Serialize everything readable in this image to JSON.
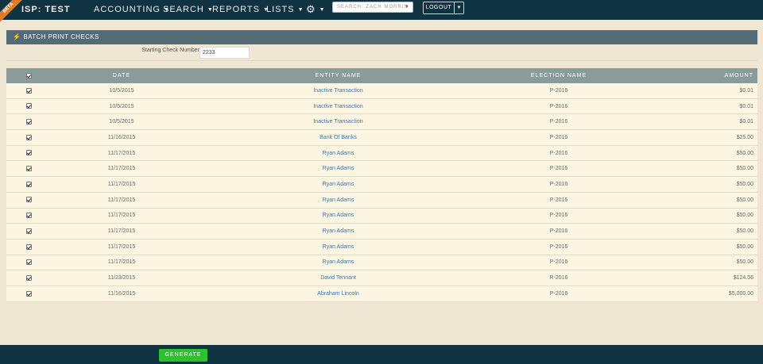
{
  "nav": {
    "beta": "BETA",
    "brand": "ISP: TEST",
    "accounting": "ACCOUNTING",
    "search": "SEARCH",
    "reports": "REPORTS",
    "lists": "LISTS",
    "gear": "⚙",
    "user_search_value": "SEARCH: ZACH MORRIS",
    "logout": "LOGOUT"
  },
  "panel": {
    "title": "BATCH PRINT CHECKS",
    "check_number_label": "Starting Check Number",
    "check_number_value": "2233"
  },
  "table": {
    "columns": [
      "DATE",
      "ENTITY NAME",
      "ELECTION NAME",
      "AMOUNT"
    ],
    "rows": [
      {
        "date": "10/5/2015",
        "entity": "Inactive Transaction",
        "election": "P-2016",
        "amount": "$0.01"
      },
      {
        "date": "10/5/2015",
        "entity": "Inactive Transaction",
        "election": "P-2016",
        "amount": "$0.01"
      },
      {
        "date": "10/5/2015",
        "entity": "Inactive Transaction",
        "election": "P-2016",
        "amount": "$0.01"
      },
      {
        "date": "11/16/2015",
        "entity": "Bank Of Banks",
        "election": "P-2016",
        "amount": "$25.00"
      },
      {
        "date": "11/17/2015",
        "entity": "Ryan Adams",
        "election": "P-2016",
        "amount": "$50.00"
      },
      {
        "date": "11/17/2015",
        "entity": "Ryan Adams",
        "election": "P-2016",
        "amount": "$50.00"
      },
      {
        "date": "11/17/2015",
        "entity": "Ryan Adams",
        "election": "P-2016",
        "amount": "$50.00"
      },
      {
        "date": "11/17/2015",
        "entity": "Ryan Adams",
        "election": "P-2016",
        "amount": "$50.00"
      },
      {
        "date": "11/17/2015",
        "entity": "Ryan Adams",
        "election": "P-2016",
        "amount": "$50.00"
      },
      {
        "date": "11/17/2015",
        "entity": "Ryan Adams",
        "election": "P-2016",
        "amount": "$50.00"
      },
      {
        "date": "11/17/2015",
        "entity": "Ryan Adams",
        "election": "P-2016",
        "amount": "$50.00"
      },
      {
        "date": "11/17/2015",
        "entity": "Ryan Adams",
        "election": "P-2016",
        "amount": "$50.00"
      },
      {
        "date": "11/23/2015",
        "entity": "David Tennant",
        "election": "R-2016",
        "amount": "$124.56"
      },
      {
        "date": "11/16/2015",
        "entity": "Abraham Lincoln",
        "election": "P-2016",
        "amount": "$5,000.00"
      }
    ]
  },
  "footer": {
    "generate": "GENERATE"
  },
  "colors": {
    "navbar": "#0f3340",
    "panel_header": "#536b74",
    "table_header": "#8a9c9a",
    "row_bg": "#fbf5e2",
    "link": "#3a7ab0",
    "generate": "#2cc12e",
    "beta": "#e07b2a"
  }
}
